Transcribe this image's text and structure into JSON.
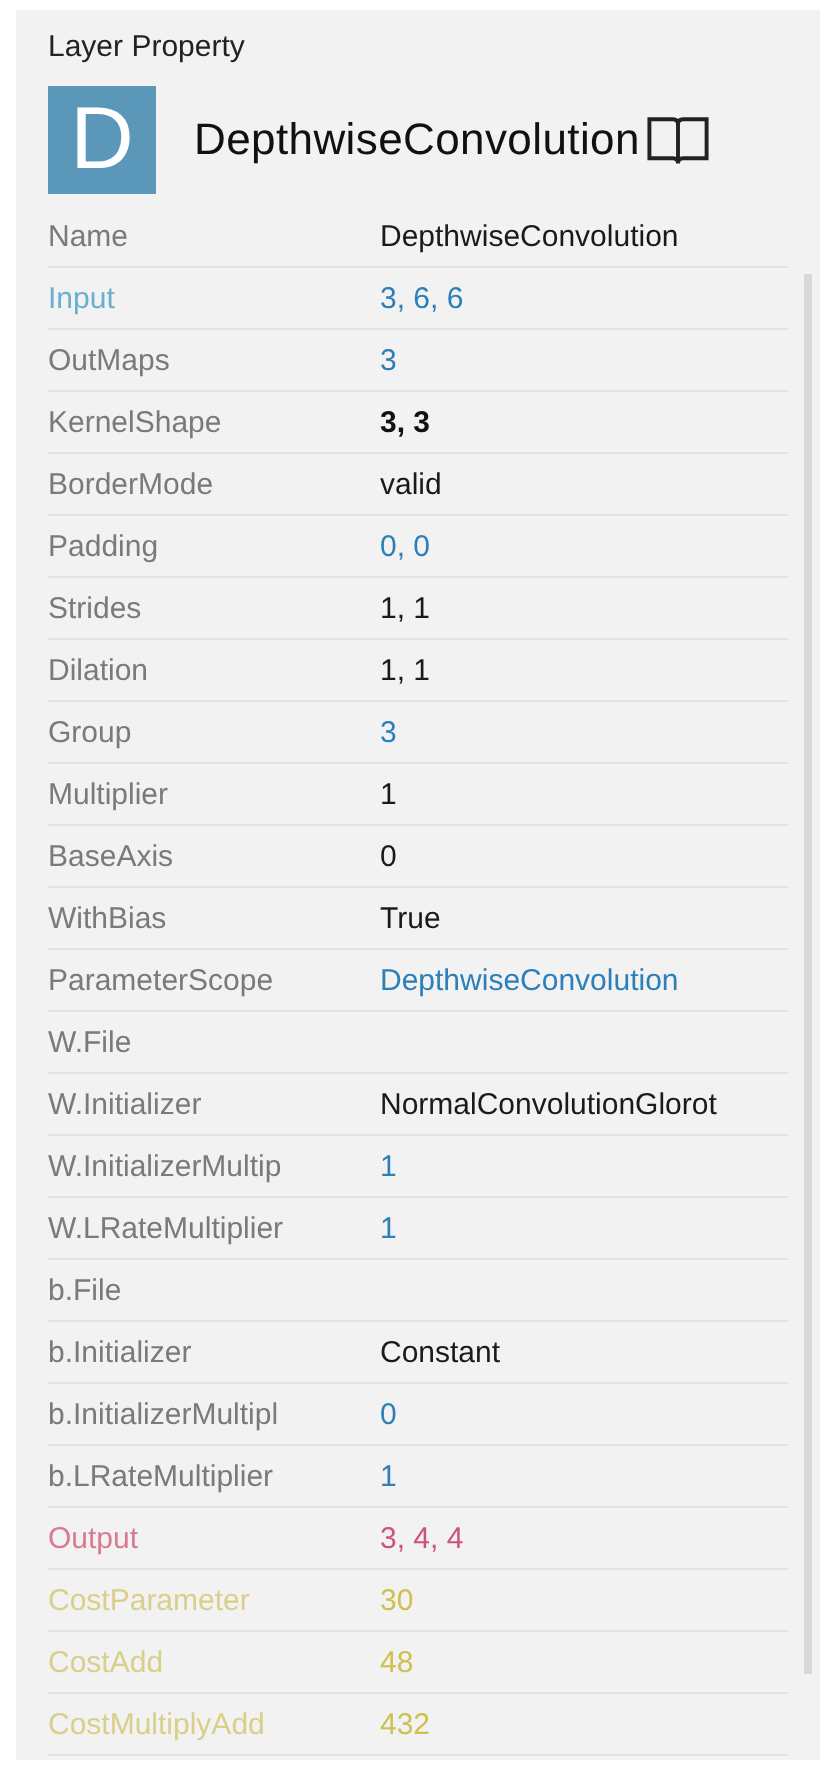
{
  "panel": {
    "title": "Layer Property"
  },
  "layer": {
    "icon_letter": "D",
    "name": "DepthwiseConvolution"
  },
  "properties": [
    {
      "label": "Name",
      "kind": "param",
      "value": {
        "text": "DepthwiseConvolution",
        "kind": "plain"
      }
    },
    {
      "label": "Input",
      "kind": "input",
      "value": {
        "text": "3, 6, 6",
        "kind": "number"
      }
    },
    {
      "label": "OutMaps",
      "kind": "param",
      "value": {
        "text": "3",
        "kind": "number"
      }
    },
    {
      "label": "KernelShape",
      "kind": "param",
      "value": {
        "text": "3, 3",
        "kind": "emphasis"
      }
    },
    {
      "label": "BorderMode",
      "kind": "param",
      "value": {
        "text": "valid",
        "kind": "plain"
      }
    },
    {
      "label": "Padding",
      "kind": "param",
      "value": {
        "text": "0, 0",
        "kind": "number"
      }
    },
    {
      "label": "Strides",
      "kind": "param",
      "value": {
        "text": "1, 1",
        "kind": "plain"
      }
    },
    {
      "label": "Dilation",
      "kind": "param",
      "value": {
        "text": "1, 1",
        "kind": "plain"
      }
    },
    {
      "label": "Group",
      "kind": "param",
      "value": {
        "text": "3",
        "kind": "number"
      }
    },
    {
      "label": "Multiplier",
      "kind": "param",
      "value": {
        "text": "1",
        "kind": "plain"
      }
    },
    {
      "label": "BaseAxis",
      "kind": "param",
      "value": {
        "text": "0",
        "kind": "plain"
      }
    },
    {
      "label": "WithBias",
      "kind": "param",
      "value": {
        "text": "True",
        "kind": "plain"
      }
    },
    {
      "label": "ParameterScope",
      "kind": "param",
      "value": {
        "text": "DepthwiseConvolution",
        "kind": "number"
      }
    },
    {
      "label": "W.File",
      "kind": "param"
    },
    {
      "label": "W.Initializer",
      "kind": "param",
      "value": {
        "text": "NormalConvolutionGlorot",
        "kind": "plain"
      }
    },
    {
      "label": "W.InitializerMultip",
      "kind": "param",
      "value": {
        "text": "1",
        "kind": "number"
      }
    },
    {
      "label": "W.LRateMultiplier",
      "kind": "param",
      "value": {
        "text": "1",
        "kind": "number"
      }
    },
    {
      "label": "b.File",
      "kind": "param"
    },
    {
      "label": "b.Initializer",
      "kind": "param",
      "value": {
        "text": "Constant",
        "kind": "plain"
      }
    },
    {
      "label": "b.InitializerMultipl",
      "kind": "param",
      "value": {
        "text": "0",
        "kind": "number"
      }
    },
    {
      "label": "b.LRateMultiplier",
      "kind": "param",
      "value": {
        "text": "1",
        "kind": "number"
      }
    },
    {
      "label": "Output",
      "kind": "output",
      "value": {
        "text": "3, 4, 4",
        "kind": "output"
      }
    },
    {
      "label": "CostParameter",
      "kind": "cost",
      "value": {
        "text": "30",
        "kind": "cost"
      }
    },
    {
      "label": "CostAdd",
      "kind": "cost",
      "value": {
        "text": "48",
        "kind": "cost"
      }
    },
    {
      "label": "CostMultiplyAdd",
      "kind": "cost",
      "value": {
        "text": "432",
        "kind": "cost"
      }
    }
  ]
}
